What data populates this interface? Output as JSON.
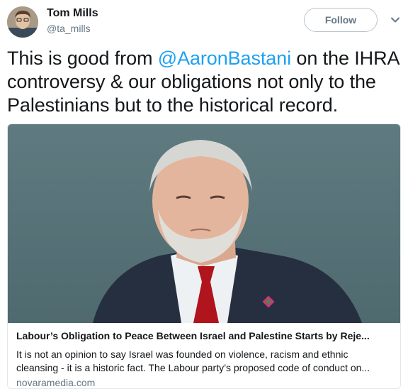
{
  "author": {
    "name": "Tom Mills",
    "handle": "@ta_mills"
  },
  "follow_label": "Follow",
  "tweet": {
    "text_before": "This is good from ",
    "mention": "@AaronBastani",
    "text_after": " on the IHRA controversy & our obligations not only to the Palestinians but to the historical record."
  },
  "card": {
    "title": "Labour’s Obligation to Peace Between Israel and Palestine Starts by Reje...",
    "description": "It is not an opinion to say Israel was founded on violence, racism and ethnic cleansing - it is a historic fact. The Labour party’s proposed code of conduct on...",
    "domain": "novaramedia.com"
  },
  "colors": {
    "link": "#1da1f2",
    "secondary_text": "#657786",
    "border": "#e1e8ed"
  },
  "icons": {
    "caret": "chevron-down-icon"
  }
}
